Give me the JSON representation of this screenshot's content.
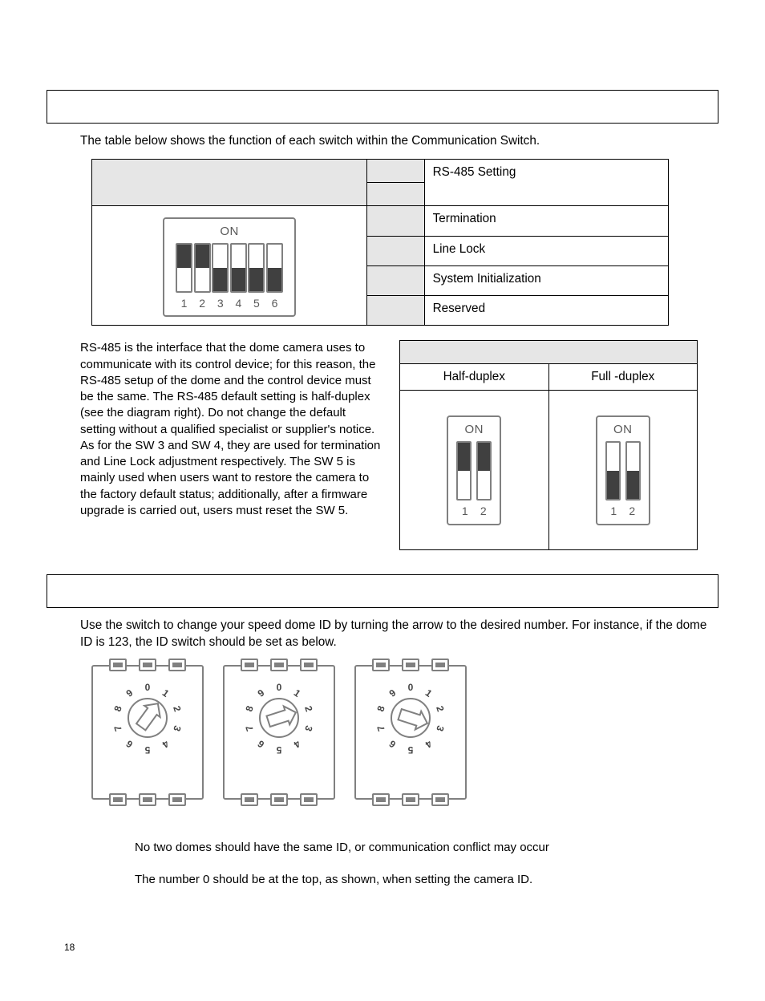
{
  "intro_table": "The table below shows the function of each switch within the Communication Switch.",
  "switch_functions": [
    "RS-485 Setting",
    "Termination",
    "Line Lock",
    "System Initialization",
    "Reserved"
  ],
  "dip6": {
    "on_label": "ON",
    "positions": [
      "up",
      "up",
      "down",
      "down",
      "down",
      "down"
    ],
    "numbers": [
      "1",
      "2",
      "3",
      "4",
      "5",
      "6"
    ]
  },
  "rs485_paragraph": "RS-485 is the interface that the dome camera uses to communicate with its control device; for this reason, the RS-485 setup of the dome and the control device must be the same. The RS-485 default setting is half-duplex (see the diagram right). Do not change the default setting without a qualified specialist or supplier's notice. As for the SW 3 and SW 4, they are used for termination and Line Lock adjustment respectively. The SW 5 is mainly used when users want to restore the camera to the factory default status; additionally, after a firmware upgrade is carried out, users must reset the SW 5.",
  "duplex": {
    "half_label": "Half-duplex",
    "full_label": "Full -duplex",
    "on_label": "ON",
    "half_positions": [
      "up",
      "up"
    ],
    "full_positions": [
      "down",
      "down"
    ],
    "numbers": [
      "1",
      "2"
    ]
  },
  "intro_id": "Use the switch to change your speed dome ID by turning the arrow to the desired number. For instance, if the dome ID is 123, the ID switch should be set as below.",
  "rotary_values": [
    1,
    2,
    3
  ],
  "dial_numbers": [
    "0",
    "1",
    "2",
    "3",
    "4",
    "5",
    "6",
    "7",
    "8",
    "9"
  ],
  "notes": [
    "No two domes should have the same ID, or communication conflict may occur",
    "The number 0 should be at the top, as shown, when setting the camera ID."
  ],
  "page_number": "18"
}
